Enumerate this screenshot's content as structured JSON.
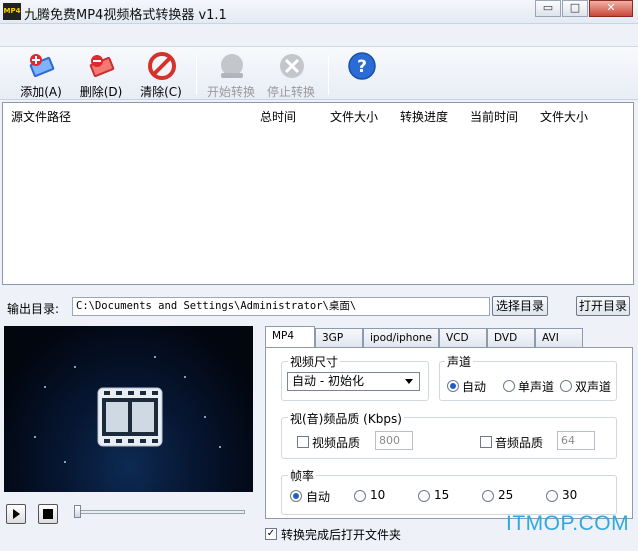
{
  "window": {
    "icon_text": "MP4",
    "title": "九腾免费MP4视频格式转换器 v1.1",
    "minimize": "▭",
    "maximize": "□",
    "close": "✕"
  },
  "toolbar": {
    "add": "添加(A)",
    "delete": "删除(D)",
    "clear": "清除(C)",
    "start": "开始转换",
    "stop": "停止转换"
  },
  "file_list": {
    "columns": [
      "源文件路径",
      "总时间",
      "文件大小",
      "转换进度",
      "当前时间",
      "文件大小"
    ]
  },
  "output": {
    "label": "输出目录:",
    "path": "C:\\Documents and Settings\\Administrator\\桌面\\",
    "choose": "选择目录",
    "open": "打开目录"
  },
  "tabs": [
    "MP4",
    "3GP",
    "ipod/iphone",
    "VCD",
    "DVD",
    "AVI"
  ],
  "video_size": {
    "title": "视频尺寸",
    "value": "自动 - 初始化"
  },
  "channel": {
    "title": "声道",
    "options": [
      "自动",
      "单声道",
      "双声道"
    ],
    "selected": "自动"
  },
  "quality": {
    "title": "视(音)频品质 (Kbps)",
    "video_label": "视频品质",
    "video_value": "800",
    "audio_label": "音频品质",
    "audio_value": "64"
  },
  "framerate": {
    "title": "帧率",
    "options": [
      "自动",
      "10",
      "15",
      "25",
      "30"
    ],
    "selected": "自动"
  },
  "open_after": {
    "label": "转换完成后打开文件夹",
    "checked": true
  },
  "watermark": "ITMOP.COM",
  "colors": {
    "accent_blue": "#2b6bd6",
    "watermark": "#2fa8e0"
  }
}
